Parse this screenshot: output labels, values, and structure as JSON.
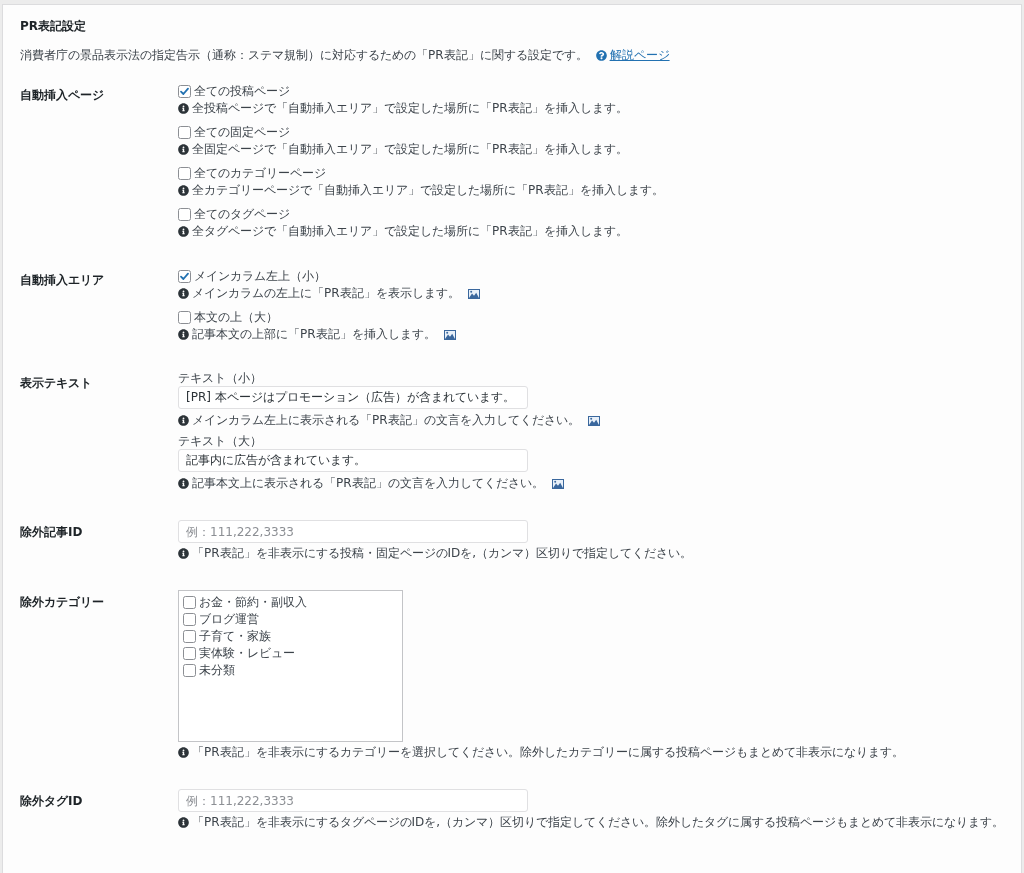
{
  "section": {
    "title": "PR表記設定",
    "description": "消費者庁の景品表示法の指定告示（通称：ステマ規制）に対応するための「PR表記」に関する設定です。",
    "help_link": "解説ページ"
  },
  "rows": [
    {
      "kind": "checkboxes",
      "label": "自動挿入ページ",
      "options": [
        {
          "label": "全ての投稿ページ",
          "checked": true,
          "hint": "全投稿ページで「自動挿入エリア」で設定した場所に「PR表記」を挿入します。",
          "preview": false
        },
        {
          "label": "全ての固定ページ",
          "checked": false,
          "hint": "全固定ページで「自動挿入エリア」で設定した場所に「PR表記」を挿入します。",
          "preview": false
        },
        {
          "label": "全てのカテゴリーページ",
          "checked": false,
          "hint": "全カテゴリーページで「自動挿入エリア」で設定した場所に「PR表記」を挿入します。",
          "preview": false
        },
        {
          "label": "全てのタグページ",
          "checked": false,
          "hint": "全タグページで「自動挿入エリア」で設定した場所に「PR表記」を挿入します。",
          "preview": false
        }
      ]
    },
    {
      "kind": "checkboxes",
      "label": "自動挿入エリア",
      "options": [
        {
          "label": "メインカラム左上（小）",
          "checked": true,
          "hint": "メインカラムの左上に「PR表記」を表示します。",
          "preview": true
        },
        {
          "label": "本文の上（大）",
          "checked": false,
          "hint": "記事本文の上部に「PR表記」を挿入します。",
          "preview": true
        }
      ]
    },
    {
      "kind": "text_fields",
      "label": "表示テキスト",
      "fields": [
        {
          "caption": "テキスト（小）",
          "value": "[PR] 本ページはプロモーション（広告）が含まれています。",
          "hint": "メインカラム左上に表示される「PR表記」の文言を入力してください。",
          "preview": true
        },
        {
          "caption": "テキスト（大）",
          "value": "記事内に広告が含まれています。",
          "hint": "記事本文上に表示される「PR表記」の文言を入力してください。",
          "preview": true
        }
      ]
    },
    {
      "kind": "input",
      "label": "除外記事ID",
      "placeholder": "例：111,222,3333",
      "hint": "「PR表記」を非表示にする投稿・固定ページのIDを,（カンマ）区切りで指定してください。"
    },
    {
      "kind": "checklist",
      "label": "除外カテゴリー",
      "items": [
        {
          "label": "お金・節約・副収入",
          "checked": false
        },
        {
          "label": "ブログ運営",
          "checked": false
        },
        {
          "label": "子育て・家族",
          "checked": false
        },
        {
          "label": "実体験・レビュー",
          "checked": false
        },
        {
          "label": "未分類",
          "checked": false
        }
      ],
      "hint": "「PR表記」を非表示にするカテゴリーを選択してください。除外したカテゴリーに属する投稿ページもまとめて非表示になります。"
    },
    {
      "kind": "input",
      "label": "除外タグID",
      "placeholder": "例：111,222,3333",
      "hint": "「PR表記」を非表示にするタグページのIDを,（カンマ）区切りで指定してください。除外したタグに属する投稿ページもまとめて非表示になります。"
    }
  ]
}
